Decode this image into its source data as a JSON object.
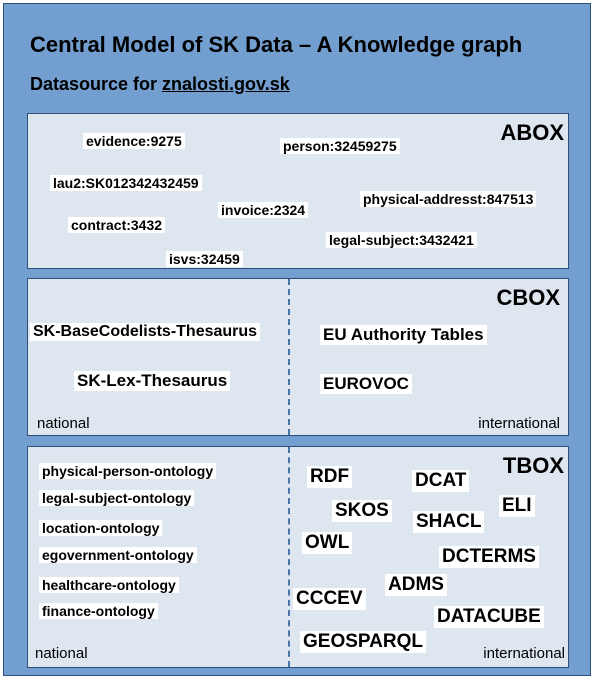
{
  "title": "Central Model of SK Data – A Knowledge graph",
  "subtitle": {
    "prefix": "Datasource for ",
    "link": "znalosti.gov.sk"
  },
  "abox": {
    "label": "ABOX",
    "items": [
      "evidence:9275",
      "person:32459275",
      "lau2:SK012342432459",
      "physical-addresst:847513",
      "invoice:2324",
      "contract:3432",
      "legal-subject:3432421",
      "isvs:32459"
    ]
  },
  "cbox": {
    "label": "CBOX",
    "national_items": [
      "SK-BaseCodelists-Thesaurus",
      "SK-Lex-Thesaurus"
    ],
    "international_items": [
      "EU Authority Tables",
      "EUROVOC"
    ],
    "national_label": "national",
    "international_label": "international"
  },
  "tbox": {
    "label": "TBOX",
    "national_items": [
      "physical-person-ontology",
      "legal-subject-ontology",
      "location-ontology",
      "egovernment-ontology",
      "healthcare-ontology",
      "finance-ontology"
    ],
    "international_items": [
      "RDF",
      "DCAT",
      "ELI",
      "SKOS",
      "SHACL",
      "OWL",
      "DCTERMS",
      "ADMS",
      "CCCEV",
      "DATACUBE",
      "GEOSPARQL"
    ],
    "national_label": "national",
    "international_label": "international"
  },
  "colors": {
    "outer_background": "#729fcf",
    "box_background": "#dee6ef",
    "border": "#2f4f77",
    "divider": "#4a73a8"
  }
}
